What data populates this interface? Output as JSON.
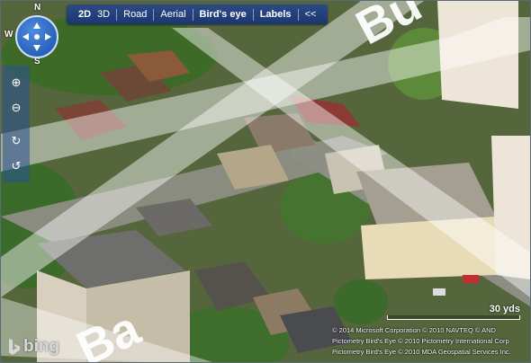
{
  "toolbar": {
    "view_2d": "2D",
    "view_3d": "3D",
    "road": "Road",
    "aerial": "Aerial",
    "birdseye": "Bird's eye",
    "labels": "Labels",
    "collapse": "<<"
  },
  "compass": {
    "n": "N",
    "s": "S",
    "w": "W"
  },
  "scale": {
    "label": "30 yds"
  },
  "copyright": [
    "© 2014 Microsoft Corporation   © 2010 NAVTEQ   © AND",
    "Pictometry Bird's Eye © 2010 Pictometry International Corp",
    "Pictometry Bird's Eye © 2010 MDA Geospatial Services Inc."
  ],
  "brand": {
    "name": "bing"
  },
  "street_labels": {
    "top_right": "Bu",
    "bottom_left": "Ba"
  },
  "colors": {
    "toolbar": "#1c3770",
    "road_overlay": "#ffffff",
    "foliage": "#3f6b2a"
  },
  "icons": [
    "pan-compass-icon",
    "zoom-in-icon",
    "zoom-out-icon",
    "rotate-cw-icon",
    "rotate-ccw-icon",
    "bing-logo-icon"
  ]
}
